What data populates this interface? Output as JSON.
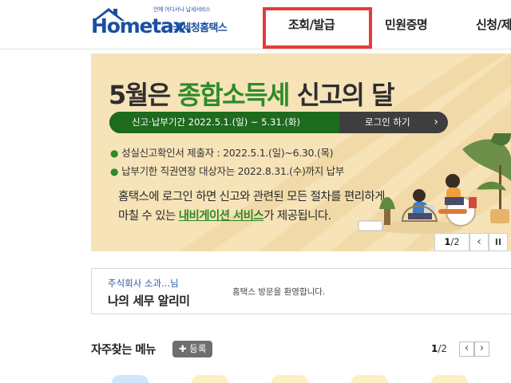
{
  "header": {
    "logo_tagline": "언제 어디서나 납세서비스",
    "logo_main": "Hometax.",
    "logo_sub": "국세청홈택스",
    "nav": [
      "조회/발급",
      "민원증명",
      "신청/제출"
    ]
  },
  "banner": {
    "title_prefix": "5월은 ",
    "title_highlight": "종합소득세",
    "title_suffix": " 신고의 달",
    "period_label": "신고·납부기간  2022.5.1.(일) ~ 5.31.(화)",
    "login_button": "로그인 하기",
    "bullets": [
      "성실신고확인서 제출자 : 2022.5.1.(일)~6.30.(목)",
      "납부기한 직권연장 대상자는 2022.8.31.(수)까지 납부"
    ],
    "desc_line1": "홈택스에 로그인 하면 신고와 관련된 모든 절차를 편리하게",
    "desc_line2_prefix": "마칠 수 있는 ",
    "desc_line2_link": "내비게이션 서비스",
    "desc_line2_suffix": "가 제공됩니다.",
    "pager_current": "1",
    "pager_total": "/2"
  },
  "notice": {
    "user": "주식회사 소과...님",
    "title": "나의 세무 알리미",
    "message": "홈택스 방문을 환영합니다."
  },
  "quick_menu": {
    "title": "자주찾는 메뉴",
    "register_button": "등록",
    "page_current": "1",
    "page_total": "/2"
  },
  "colors": {
    "brand_blue": "#1a4fa3",
    "accent_green": "#2f8a2a",
    "highlight_red": "#e53a3a",
    "banner_bg": "#f6e3b8"
  }
}
